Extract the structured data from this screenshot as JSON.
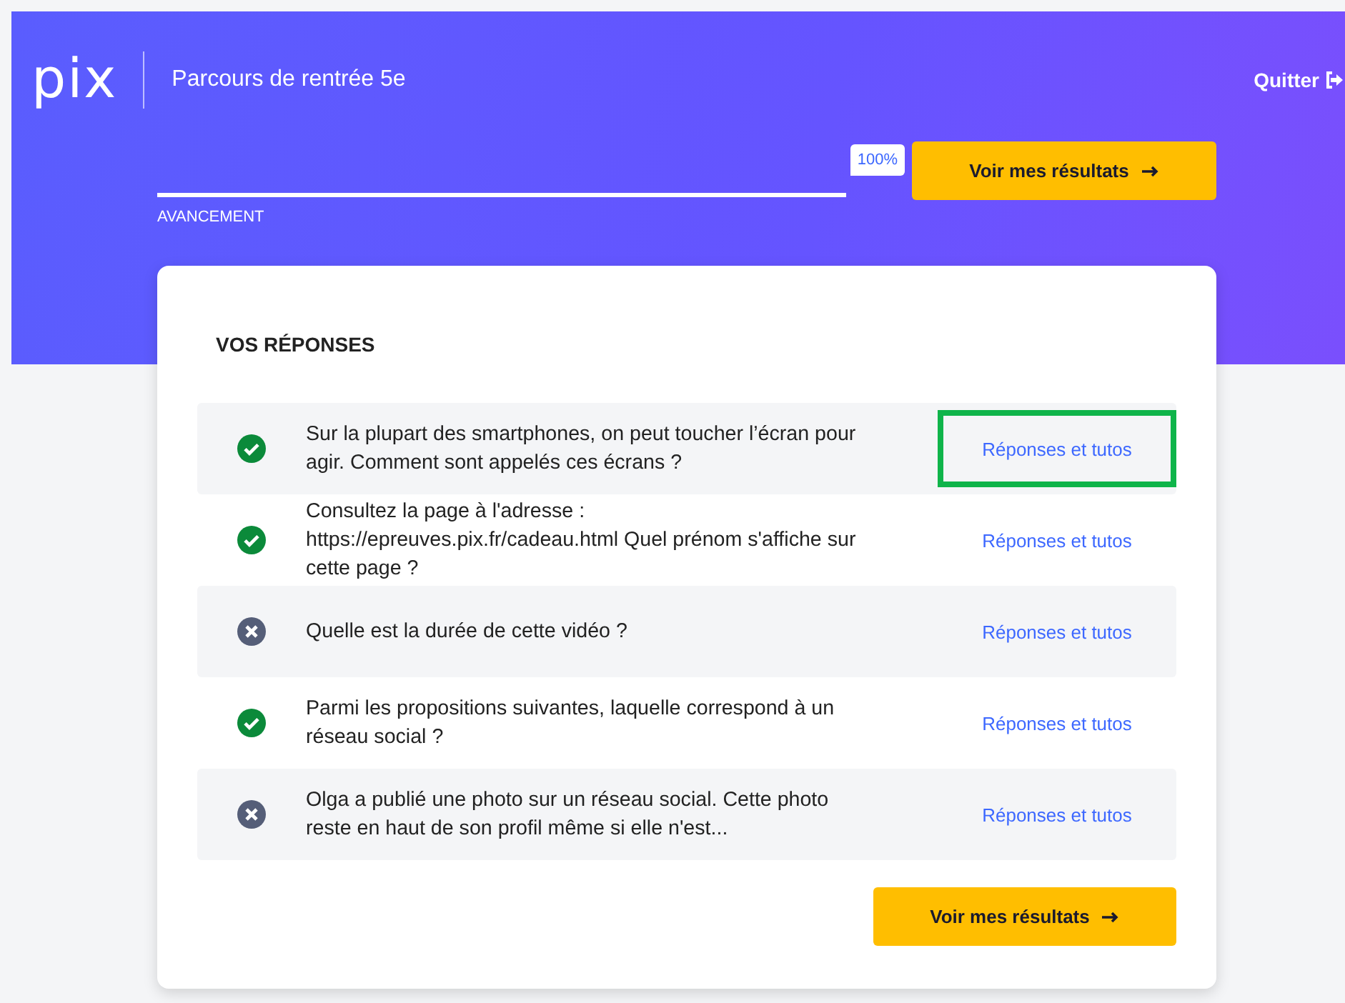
{
  "header": {
    "logo": "pix",
    "title": "Parcours de rentrée 5e",
    "quit": "Quitter"
  },
  "progress": {
    "level": 1,
    "reading": "100%",
    "label": "AVANCEMENT",
    "button": "Voir mes résultats"
  },
  "answers_panel": {
    "heading": "VOS RÉPONSES",
    "answers": [
      {
        "question": "Sur la plupart des smartphones, on peut toucher l’écran pour agir. Comment sont appelés ces écrans ?",
        "kind": "correct",
        "link": "Réponses et tutos",
        "highlighted": true
      },
      {
        "question": "Consultez la page à l'adresse : https://epreuves.pix.fr/cadeau.html Quel prénom s'affiche sur cette page ?",
        "kind": "correct",
        "link": "Réponses et tutos",
        "highlighted": false
      },
      {
        "question": "Quelle est la durée de cette vidéo ?",
        "kind": "wrong",
        "link": "Réponses et tutos",
        "highlighted": false
      },
      {
        "question": "Parmi les propositions suivantes, laquelle correspond à un réseau social ?",
        "kind": "correct",
        "link": "Réponses et tutos",
        "highlighted": false
      },
      {
        "question": "Olga a publié une photo sur un réseau social. Cette photo reste en haut de son profil même si elle n'est...",
        "kind": "wrong",
        "link": "Réponses et tutos",
        "highlighted": false
      }
    ],
    "button": "Voir mes résultats"
  }
}
